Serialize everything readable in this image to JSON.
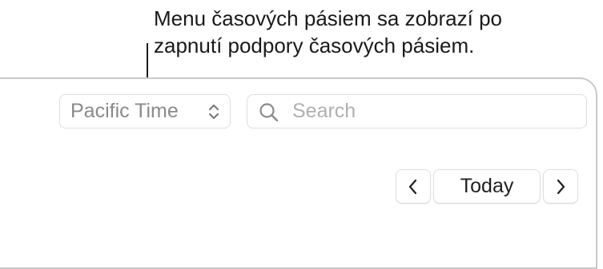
{
  "callout": {
    "line1": "Menu časových pásiem sa zobrazí po",
    "line2": "zapnutí podpory časových pásiem."
  },
  "toolbar": {
    "timezone": {
      "selected": "Pacific Time",
      "icon": "chevron-up-down-icon"
    },
    "search": {
      "placeholder": "Search",
      "value": "",
      "icon": "search-icon"
    }
  },
  "navigation": {
    "prev_icon": "chevron-left-icon",
    "today_label": "Today",
    "next_icon": "chevron-right-icon"
  },
  "colors": {
    "border": "#dedede",
    "frame": "#c9c9c9",
    "muted_text": "#8a8a8a",
    "placeholder": "#b0b0b0",
    "text": "#1a1a1a"
  }
}
